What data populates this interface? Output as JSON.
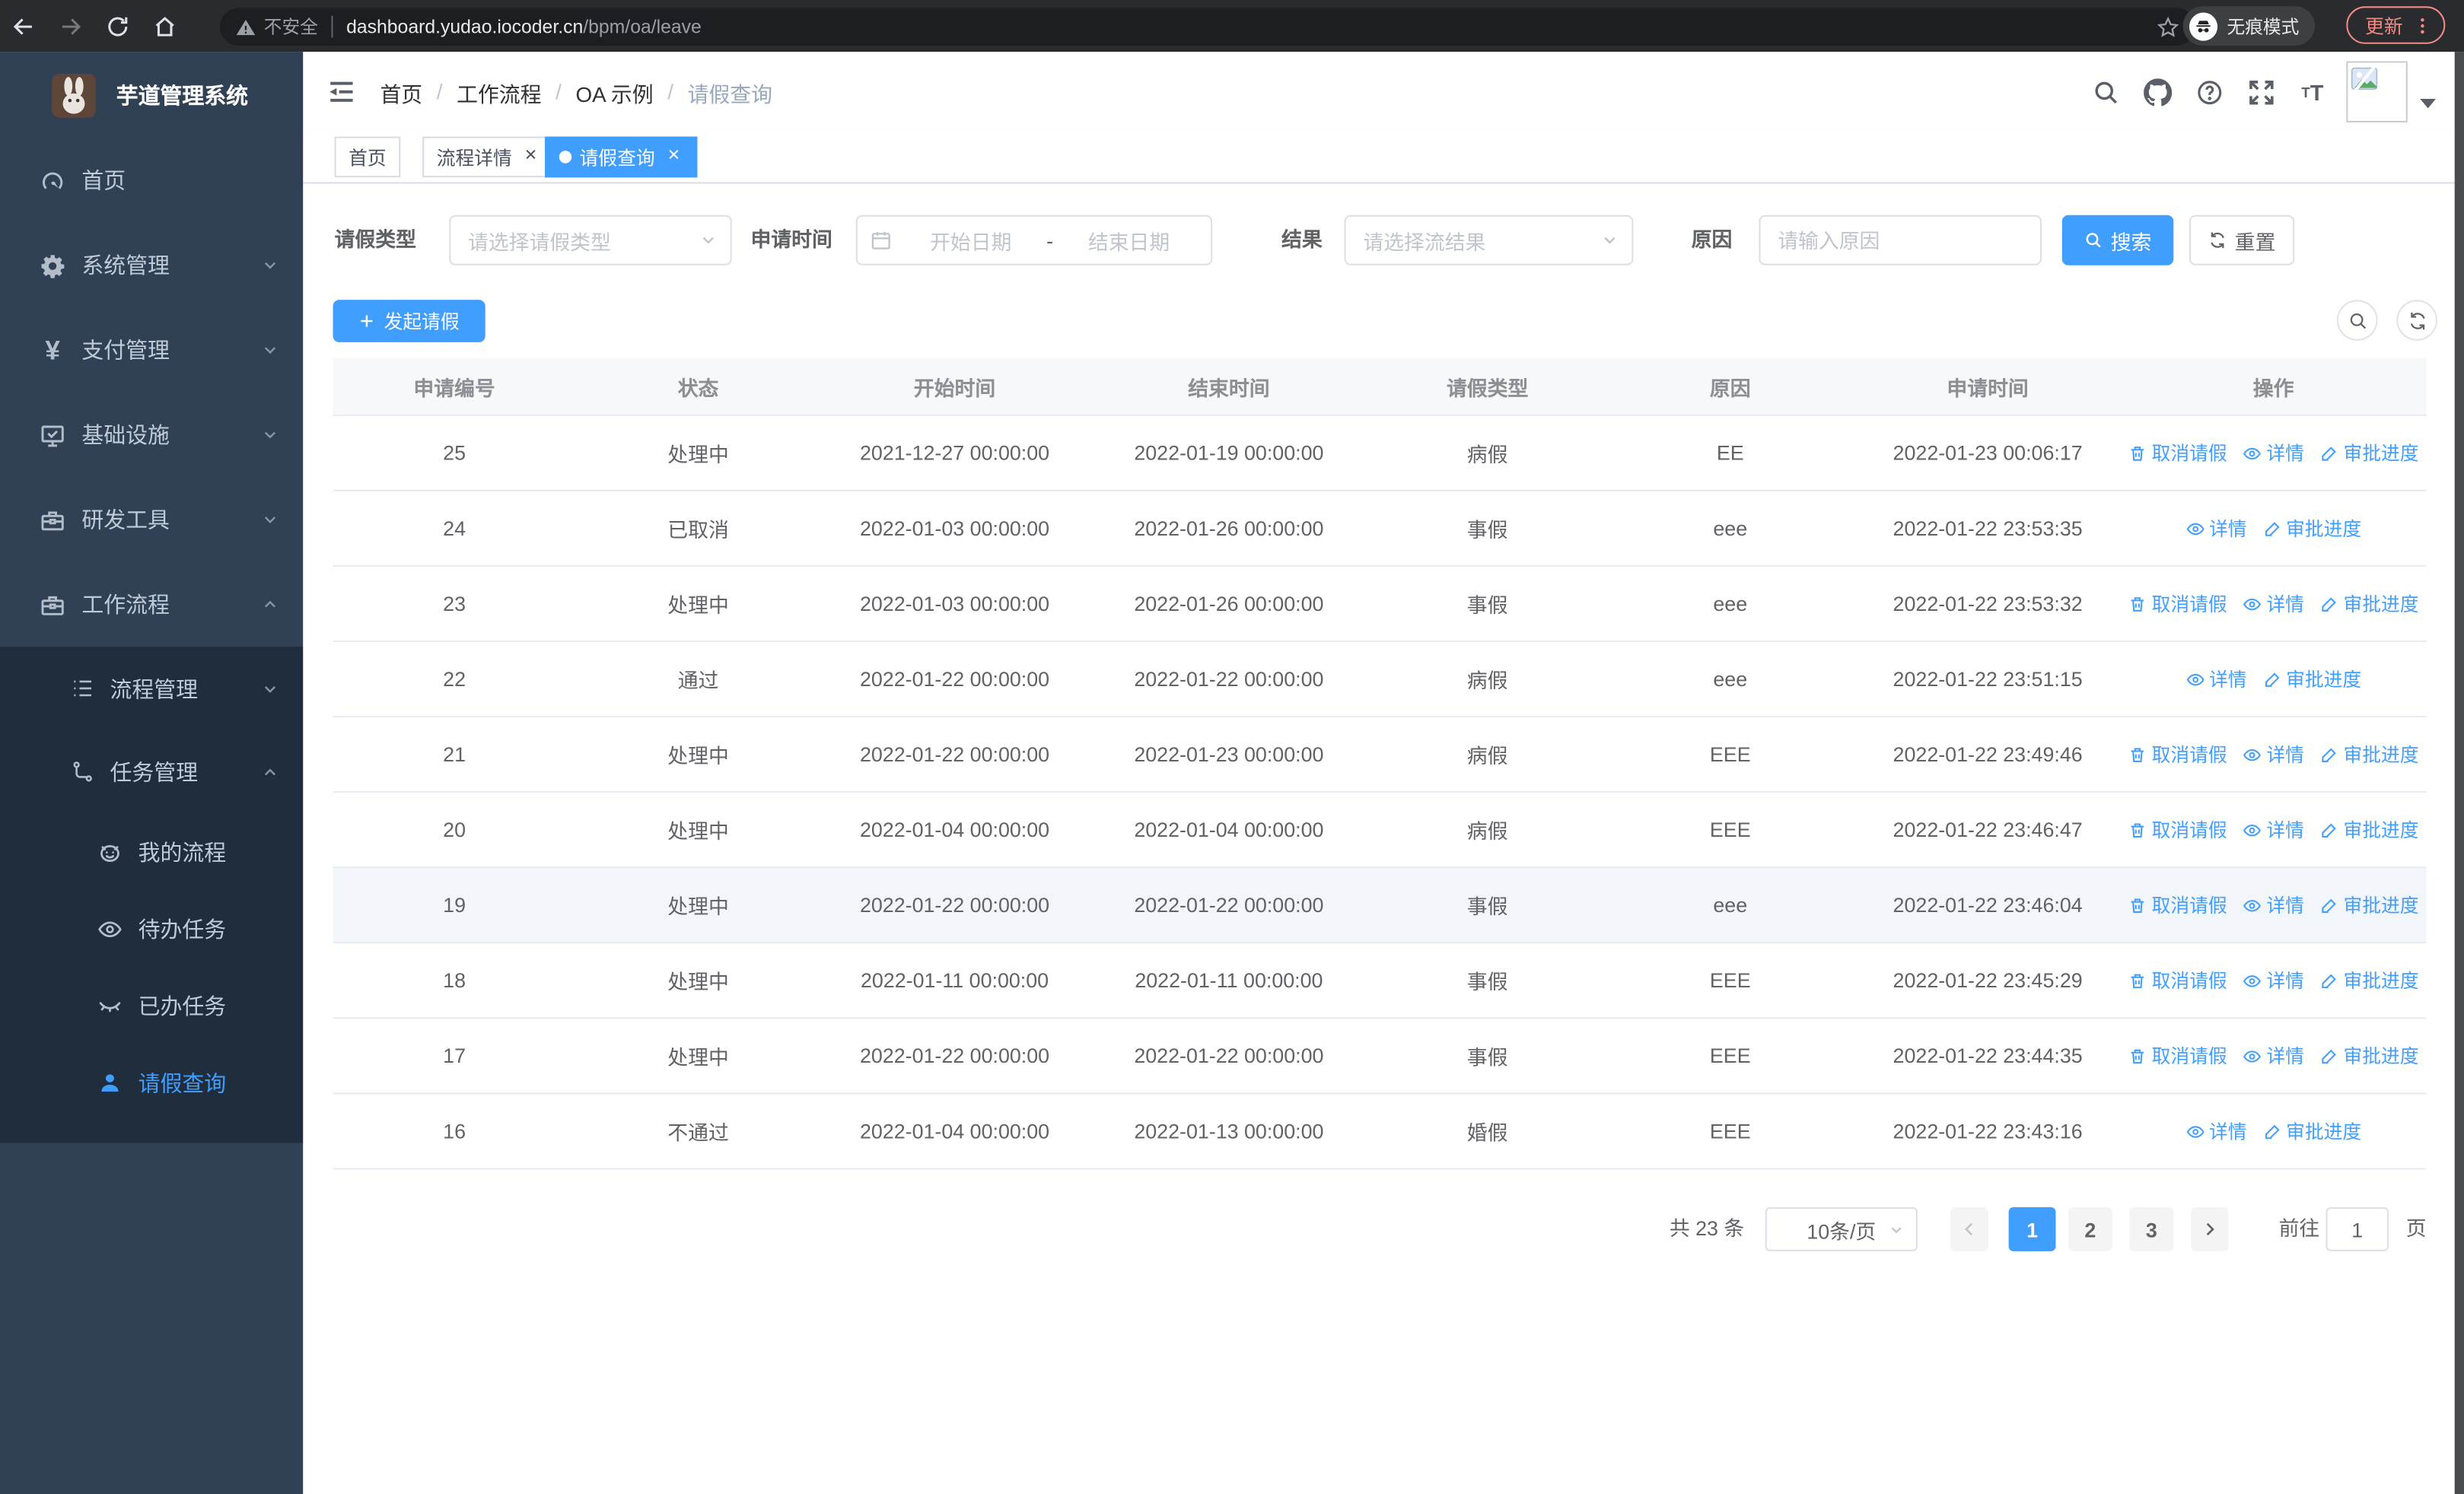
{
  "browser": {
    "security_label": "不安全",
    "url_domain": "dashboard.yudao.iocoder.cn",
    "url_path": "/bpm/oa/leave",
    "incognito_label": "无痕模式",
    "update_label": "更新"
  },
  "sidebar": {
    "logo_title": "芋道管理系统",
    "menu": [
      {
        "label": "首页",
        "icon": "dashboard-icon"
      },
      {
        "label": "系统管理",
        "icon": "gear-icon"
      },
      {
        "label": "支付管理",
        "icon": "yen-icon"
      },
      {
        "label": "基础设施",
        "icon": "monitor-icon"
      },
      {
        "label": "研发工具",
        "icon": "toolbox-icon"
      },
      {
        "label": "工作流程",
        "icon": "briefcase-icon"
      }
    ],
    "submenu": [
      {
        "label": "流程管理",
        "icon": "list-icon"
      },
      {
        "label": "任务管理",
        "icon": "workflow-icon"
      }
    ],
    "task_children": [
      {
        "label": "我的流程",
        "icon": "face-icon"
      },
      {
        "label": "待办任务",
        "icon": "eye-open-icon"
      },
      {
        "label": "已办任务",
        "icon": "eye-closed-icon"
      },
      {
        "label": "请假查询",
        "icon": "user-icon",
        "active": true
      }
    ]
  },
  "navbar": {
    "breadcrumb": [
      "首页",
      "工作流程",
      "OA 示例",
      "请假查询"
    ]
  },
  "tabs": [
    {
      "label": "首页",
      "closable": false,
      "active": false
    },
    {
      "label": "流程详情",
      "closable": true,
      "active": false
    },
    {
      "label": "请假查询",
      "closable": true,
      "active": true
    }
  ],
  "filters": {
    "leave_type_label": "请假类型",
    "leave_type_placeholder": "请选择请假类型",
    "apply_time_label": "申请时间",
    "start_placeholder": "开始日期",
    "range_separator": "-",
    "end_placeholder": "结束日期",
    "result_label": "结果",
    "result_placeholder": "请选择流结果",
    "reason_label": "原因",
    "reason_placeholder": "请输入原因",
    "search_label": "搜索",
    "reset_label": "重置"
  },
  "toolbar": {
    "create_label": "发起请假"
  },
  "table": {
    "columns": [
      "申请编号",
      "状态",
      "开始时间",
      "结束时间",
      "请假类型",
      "原因",
      "申请时间",
      "操作"
    ],
    "action_icons": {
      "取消请假": "trash-icon",
      "详情": "eye-icon",
      "审批进度": "edit-icon"
    },
    "rows": [
      {
        "id": "25",
        "status": "处理中",
        "start": "2021-12-27 00:00:00",
        "end": "2022-01-19 00:00:00",
        "type": "病假",
        "reason": "EE",
        "apply_time": "2022-01-23 00:06:17",
        "actions": [
          "取消请假",
          "详情",
          "审批进度"
        ],
        "highlight": false
      },
      {
        "id": "24",
        "status": "已取消",
        "start": "2022-01-03 00:00:00",
        "end": "2022-01-26 00:00:00",
        "type": "事假",
        "reason": "eee",
        "apply_time": "2022-01-22 23:53:35",
        "actions": [
          "详情",
          "审批进度"
        ],
        "highlight": false
      },
      {
        "id": "23",
        "status": "处理中",
        "start": "2022-01-03 00:00:00",
        "end": "2022-01-26 00:00:00",
        "type": "事假",
        "reason": "eee",
        "apply_time": "2022-01-22 23:53:32",
        "actions": [
          "取消请假",
          "详情",
          "审批进度"
        ],
        "highlight": false
      },
      {
        "id": "22",
        "status": "通过",
        "start": "2022-01-22 00:00:00",
        "end": "2022-01-22 00:00:00",
        "type": "病假",
        "reason": "eee",
        "apply_time": "2022-01-22 23:51:15",
        "actions": [
          "详情",
          "审批进度"
        ],
        "highlight": false
      },
      {
        "id": "21",
        "status": "处理中",
        "start": "2022-01-22 00:00:00",
        "end": "2022-01-23 00:00:00",
        "type": "病假",
        "reason": "EEE",
        "apply_time": "2022-01-22 23:49:46",
        "actions": [
          "取消请假",
          "详情",
          "审批进度"
        ],
        "highlight": false
      },
      {
        "id": "20",
        "status": "处理中",
        "start": "2022-01-04 00:00:00",
        "end": "2022-01-04 00:00:00",
        "type": "病假",
        "reason": "EEE",
        "apply_time": "2022-01-22 23:46:47",
        "actions": [
          "取消请假",
          "详情",
          "审批进度"
        ],
        "highlight": false
      },
      {
        "id": "19",
        "status": "处理中",
        "start": "2022-01-22 00:00:00",
        "end": "2022-01-22 00:00:00",
        "type": "事假",
        "reason": "eee",
        "apply_time": "2022-01-22 23:46:04",
        "actions": [
          "取消请假",
          "详情",
          "审批进度"
        ],
        "highlight": true
      },
      {
        "id": "18",
        "status": "处理中",
        "start": "2022-01-11 00:00:00",
        "end": "2022-01-11 00:00:00",
        "type": "事假",
        "reason": "EEE",
        "apply_time": "2022-01-22 23:45:29",
        "actions": [
          "取消请假",
          "详情",
          "审批进度"
        ],
        "highlight": false
      },
      {
        "id": "17",
        "status": "处理中",
        "start": "2022-01-22 00:00:00",
        "end": "2022-01-22 00:00:00",
        "type": "事假",
        "reason": "EEE",
        "apply_time": "2022-01-22 23:44:35",
        "actions": [
          "取消请假",
          "详情",
          "审批进度"
        ],
        "highlight": false
      },
      {
        "id": "16",
        "status": "不通过",
        "start": "2022-01-04 00:00:00",
        "end": "2022-01-13 00:00:00",
        "type": "婚假",
        "reason": "EEE",
        "apply_time": "2022-01-22 23:43:16",
        "actions": [
          "详情",
          "审批进度"
        ],
        "highlight": false
      }
    ]
  },
  "pagination": {
    "total_label": "共 23 条",
    "page_size_label": "10条/页",
    "pages": [
      "1",
      "2",
      "3"
    ],
    "active_page": "1",
    "goto_label": "前往",
    "goto_value": "1",
    "goto_unit": "页"
  },
  "colors": {
    "accent": "#409eff",
    "sidebar": "#304156",
    "sidebar_sub": "#1f2d3d"
  }
}
